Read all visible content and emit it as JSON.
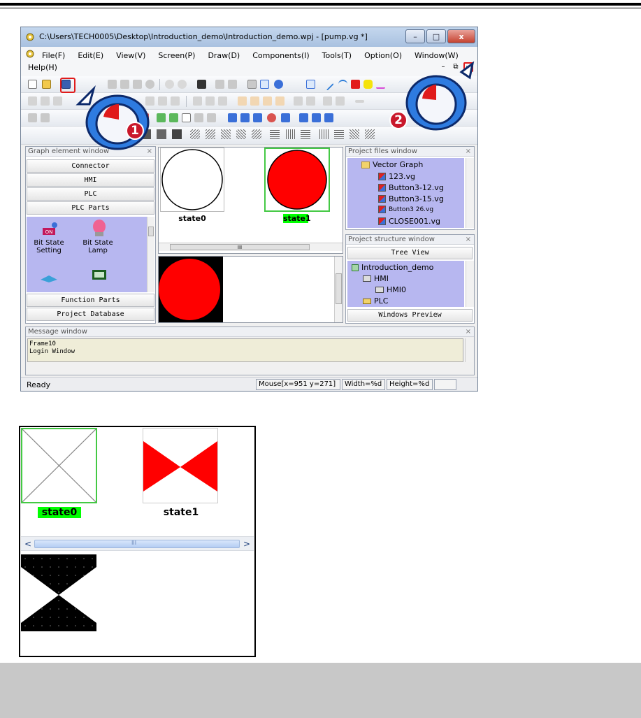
{
  "window": {
    "title": "C:\\Users\\TECH0005\\Desktop\\Introduction_demo\\Introduction_demo.wpj - [pump.vg *]",
    "buttons": {
      "minimize": "–",
      "maximize": "□",
      "close": "x"
    }
  },
  "menu": {
    "items": [
      "File(F)",
      "Edit(E)",
      "View(V)",
      "Screen(P)",
      "Draw(D)",
      "Components(I)",
      "Tools(T)",
      "Option(O)",
      "Window(W)"
    ],
    "help": "Help(H)",
    "mdi_close": "×",
    "mdi_restore": "⧉",
    "mdi_min": "–"
  },
  "callouts": {
    "one": "1",
    "two": "2"
  },
  "graph_element_window": {
    "title": "Graph element window",
    "close": "×",
    "buttons": [
      "Connector",
      "HMI",
      "PLC",
      "PLC Parts"
    ],
    "items": [
      {
        "label": "Bit State\nSetting",
        "icon": "bit-state-setting-icon"
      },
      {
        "label": "Bit State\nLamp",
        "icon": "bit-state-lamp-icon"
      }
    ],
    "bottom_buttons": [
      "Function Parts",
      "Project Database"
    ]
  },
  "canvas": {
    "state0_label": "state0",
    "state1_label": "state1",
    "scroll_grip": "III"
  },
  "project_files_window": {
    "title": "Project files window",
    "close": "×",
    "root": "Vector Graph",
    "files": [
      "123.vg",
      "Button3-12.vg",
      "Button3-15.vg",
      "Button3 26.vg",
      "CLOSE001.vg"
    ]
  },
  "project_structure_window": {
    "title": "Project structure window",
    "close": "×",
    "tree_view_button": "Tree View",
    "nodes": [
      "Introduction_demo",
      "HMI",
      "HMI0",
      "PLC"
    ],
    "windows_preview_button": "Windows Preview"
  },
  "message_window": {
    "title": "Message window",
    "close": "×",
    "lines": [
      "Frame10",
      "Login Window"
    ]
  },
  "statusbar": {
    "ready": "Ready",
    "mouse": "Mouse[x=951  y=271]",
    "width": "Width=%d",
    "height": "Height=%d"
  },
  "preview": {
    "state0_label": "state0",
    "state1_label": "state1",
    "left_arrow": "<",
    "right_arrow": ">",
    "grip": "III"
  },
  "colors": {
    "highlight_green": "#00ff00",
    "callout_red": "#c9182b",
    "lamp_red": "#ff0000",
    "tree_bg": "#b7b7f0"
  }
}
